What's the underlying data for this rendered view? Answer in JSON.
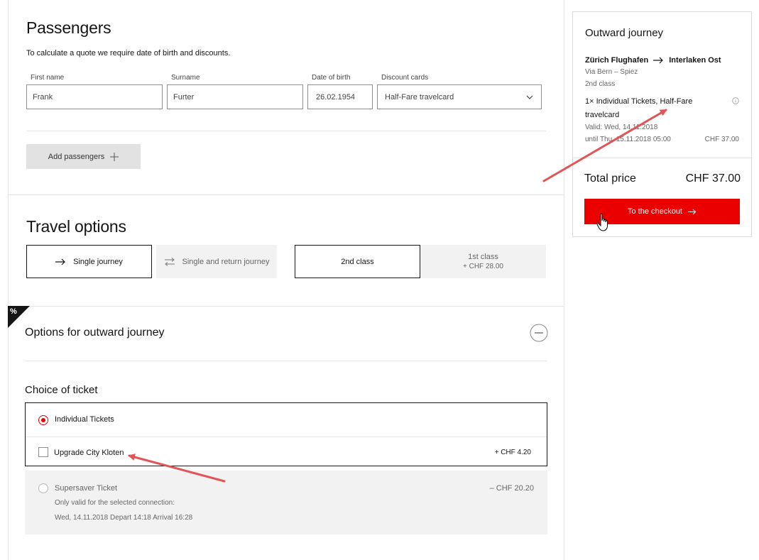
{
  "passengers": {
    "title": "Passengers",
    "subtitle": "To calculate a quote we require date of birth and discounts.",
    "first_name_label": "First name",
    "surname_label": "Surname",
    "dob_label": "Date of birth",
    "discount_label": "Discount cards",
    "first_name_value": "Frank",
    "surname_value": "Furter",
    "dob_value": "26.02.1954",
    "discount_value": "Half-Fare travelcard",
    "add_button": "Add passengers"
  },
  "travel_options": {
    "title": "Travel options",
    "single": "Single journey",
    "return": "Single and return journey",
    "second_class": "2nd class",
    "first_class": "1st class",
    "first_class_price": "+ CHF 28.00"
  },
  "outward_options": {
    "title": "Options for outward journey",
    "badge": "%",
    "choice_title": "Choice of ticket",
    "individual": "Individual Tickets",
    "upgrade": "Upgrade City Kloten",
    "upgrade_price": "+ CHF 4.20",
    "supersaver": "Supersaver Ticket",
    "supersaver_price": "– CHF 20.20",
    "supersaver_note": "Only valid for the selected connection:",
    "supersaver_connection": "Wed, 14.11.2018 Depart 14:18 Arrival 16:28"
  },
  "summary": {
    "title": "Outward journey",
    "from": "Zürich Flughafen",
    "to": "Interlaken Ost",
    "via": "Via Bern – Spiez",
    "class": "2nd class",
    "ticket_line1": "1× Individual Tickets, Half-Fare",
    "ticket_line2": "travelcard",
    "valid_from": "Valid: Wed, 14.11.2018",
    "valid_until": "until Thu, 15.11.2018 05:00",
    "ticket_price": "CHF 37.00",
    "total_label": "Total price",
    "total_value": "CHF 37.00",
    "checkout": "To the checkout"
  },
  "colors": {
    "accent": "#eb0000",
    "annotation_arrow": "#e05555"
  }
}
